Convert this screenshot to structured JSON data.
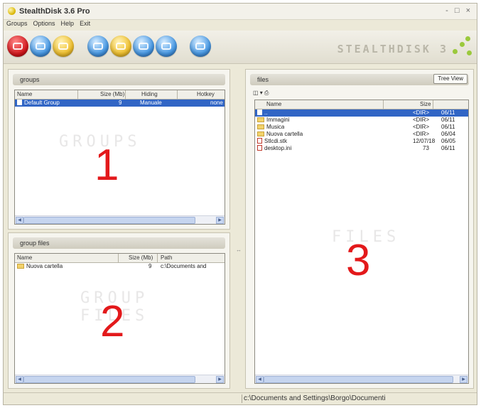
{
  "window": {
    "title": "StealthDisk 3.6 Pro",
    "controls": "- □ ×"
  },
  "menu": [
    "Groups",
    "Options",
    "Help",
    "Exit"
  ],
  "toolbar": {
    "buttons": [
      {
        "name": "toolbar-button-red",
        "color": "#d4161b"
      },
      {
        "name": "toolbar-button-blue",
        "color": "#4a9be6"
      },
      {
        "name": "toolbar-button-yellow",
        "color": "#f1c232"
      },
      {
        "name": "toolbar-button-blue-2",
        "color": "#4a9be6"
      },
      {
        "name": "toolbar-button-yellow-2",
        "color": "#f1c232"
      },
      {
        "name": "toolbar-button-blue-3",
        "color": "#4a9be6"
      },
      {
        "name": "toolbar-button-blue-4",
        "color": "#4a9be6"
      },
      {
        "name": "toolbar-button-blue-5",
        "color": "#4a9be6"
      }
    ],
    "logo_text": "STEALTHDISK 3"
  },
  "groups_panel": {
    "header": "groups",
    "columns": [
      "Name",
      "Size (Mb)",
      "Hiding",
      "Hotkey"
    ],
    "rows": [
      {
        "name": "Default Group",
        "size": "9",
        "hiding": "Manuale",
        "hotkey": "none",
        "selected": true
      }
    ],
    "overlay_number": "1",
    "overlay_ghost": "GROUPS"
  },
  "group_files_panel": {
    "header": "group files",
    "columns": [
      "Name",
      "Size (Mb)",
      "Path"
    ],
    "rows": [
      {
        "name": "Nuova cartella",
        "size": "9",
        "path": "c:\\Documents and"
      }
    ],
    "overlay_number": "2",
    "overlay_ghost": "GROUP FILES"
  },
  "files_panel": {
    "header": "files",
    "tree_view_label": "Tree View",
    "columns": [
      "Name",
      "Size",
      ""
    ],
    "rows": [
      {
        "name": "..",
        "size": "<DIR>",
        "date": "06/11",
        "type": "up",
        "selected": true
      },
      {
        "name": "Immagini",
        "size": "<DIR>",
        "date": "06/11",
        "type": "folder"
      },
      {
        "name": "Musica",
        "size": "<DIR>",
        "date": "06/11",
        "type": "folder"
      },
      {
        "name": "Nuova cartella",
        "size": "<DIR>",
        "date": "06/04",
        "type": "folder"
      },
      {
        "name": "Stlcdi.stk",
        "size": "12/07/18",
        "date": "06/05",
        "type": "file"
      },
      {
        "name": "desktop.ini",
        "size": "73",
        "date": "06/11",
        "type": "file"
      }
    ],
    "overlay_number": "3",
    "overlay_ghost": "FILES"
  },
  "status": {
    "path": "c:\\Documents and Settings\\Borgo\\Documenti"
  }
}
